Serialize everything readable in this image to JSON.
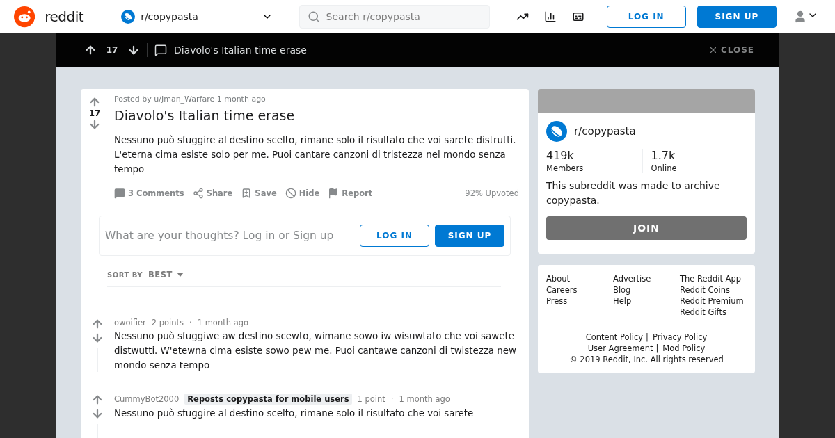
{
  "header": {
    "brand": "reddit",
    "community": "r/copypasta",
    "search": {
      "placeholder": "Search r/copypasta"
    },
    "login": "LOG IN",
    "signup": "SIGN UP"
  },
  "post_bar": {
    "score": "17",
    "title": "Diavolo's Italian time erase",
    "close": "CLOSE"
  },
  "post": {
    "byline": "Posted by u/Jman_Warfare 1 month ago",
    "score": "17",
    "title": "Diavolo's Italian time erase",
    "body": "Nessuno può sfuggire al destino scelto, rimane solo il risultato che voi sarete distrutti. L'eterna cima esiste solo per me. Puoi cantare canzoni di tristezza nel mondo senza tempo",
    "actions": [
      {
        "kind": "comments",
        "label": "3 Comments"
      },
      {
        "kind": "share",
        "label": "Share"
      },
      {
        "kind": "save",
        "label": "Save"
      },
      {
        "kind": "hide",
        "label": "Hide"
      },
      {
        "kind": "report",
        "label": "Report"
      }
    ],
    "upvoted": "92% Upvoted"
  },
  "comment_box": {
    "placeholder": "What are your thoughts? Log in or Sign up",
    "login": "LOG IN",
    "signup": "SIGN UP"
  },
  "sort": {
    "label": "SORT BY",
    "value": "BEST"
  },
  "comments": [
    {
      "author": "owoifier",
      "points": "2 points",
      "dot": "·",
      "time": "1 month ago",
      "body": "Nessuno può sfuggiwe aw destino scewto, wimane sowo iw wisuwtato che voi sawete distwutti. W'etewna cima esiste sowo pew me. Puoi cantawe canzoni di twistezza new mondo senza tempo"
    },
    {
      "author": "CummyBot2000",
      "flair": "Reposts copypasta for mobile users",
      "points": "1 point",
      "dot": "·",
      "time": "1 month ago",
      "body": "Nessuno può sfuggire al destino scelto, rimane solo il risultato che voi sarete"
    }
  ],
  "community_card": {
    "name": "r/copypasta",
    "stats": [
      {
        "value": "419k",
        "label": "Members"
      },
      {
        "value": "1.7k",
        "label": "Online"
      }
    ],
    "description": "This subreddit was made to archive copypasta.",
    "join": "JOIN"
  },
  "footer": {
    "columns": [
      [
        "About",
        "Careers",
        "Press"
      ],
      [
        "Advertise",
        "Blog",
        "Help"
      ],
      [
        "The Reddit App",
        "Reddit Coins",
        "Reddit Premium",
        "Reddit Gifts"
      ]
    ],
    "legal_rows": [
      [
        "Content Policy",
        "Privacy Policy"
      ],
      [
        "User Agreement",
        "Mod Policy"
      ]
    ],
    "separator": "|",
    "copyright": "© 2019 Reddit, Inc. All rights reserved"
  }
}
